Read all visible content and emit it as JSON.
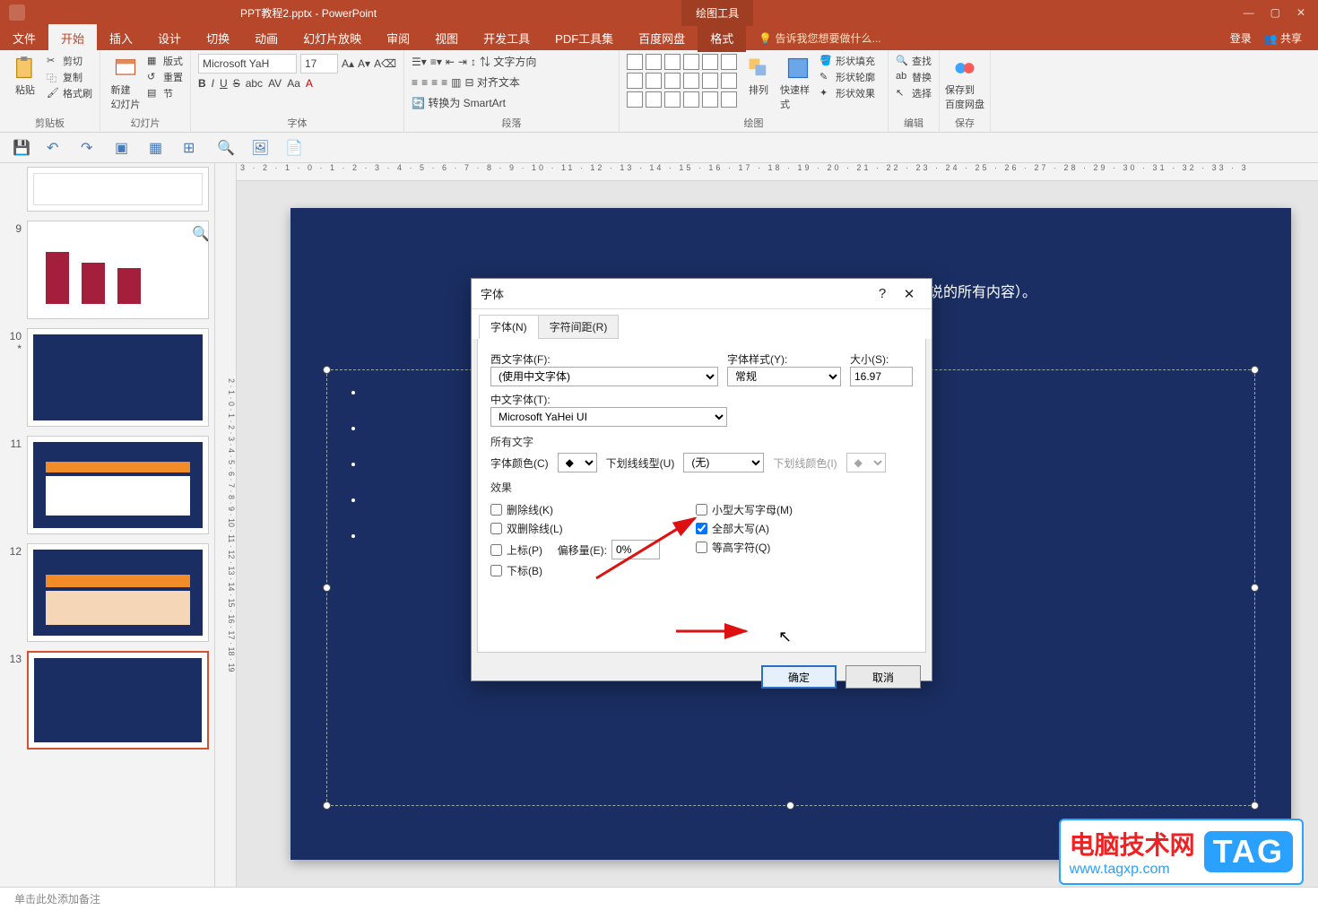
{
  "titlebar": {
    "filename": "PPT教程2.pptx - PowerPoint",
    "contextual_tab_group": "绘图工具",
    "win_min": "—",
    "win_max": "▢",
    "win_close": "✕"
  },
  "ribbon_tabs": {
    "file": "文件",
    "home": "开始",
    "insert": "插入",
    "design": "设计",
    "transitions": "切换",
    "animations": "动画",
    "slideshow": "幻灯片放映",
    "review": "审阅",
    "view": "视图",
    "developer": "开发工具",
    "pdf": "PDF工具集",
    "baidu": "百度网盘",
    "format": "格式",
    "tell_me": "告诉我您想要做什么...",
    "signin": "登录",
    "share": "共享"
  },
  "ribbon": {
    "clipboard": {
      "title": "剪贴板",
      "paste": "粘贴",
      "cut": "剪切",
      "copy": "复制",
      "painter": "格式刷"
    },
    "slides": {
      "title": "幻灯片",
      "new": "新建\n幻灯片",
      "layout": "版式",
      "reset": "重置",
      "section": "节"
    },
    "font": {
      "title": "字体",
      "name": "Microsoft YaH",
      "size": "17"
    },
    "paragraph": {
      "title": "段落",
      "direction": "文字方向",
      "align": "对齐文本",
      "smartart": "转换为 SmartArt"
    },
    "drawing": {
      "title": "绘图",
      "arrange": "排列",
      "quickstyles": "快速样式",
      "fill": "形状填充",
      "outline": "形状轮廓",
      "effects": "形状效果"
    },
    "editing": {
      "title": "编辑",
      "find": "查找",
      "replace": "替换",
      "select": "选择"
    },
    "save": {
      "title": "保存",
      "action": "保存到\n百度网盘"
    }
  },
  "slide_visible_text": "字仅作为论点（而不是你要说的所有内容）。",
  "thumbs": [
    {
      "num": ""
    },
    {
      "num": "9"
    },
    {
      "num": "10",
      "marker": "*"
    },
    {
      "num": "11"
    },
    {
      "num": "12"
    },
    {
      "num": "13"
    }
  ],
  "notes_placeholder": "单击此处添加备注",
  "dialog": {
    "title": "字体",
    "help": "?",
    "close": "✕",
    "tab_font": "字体(N)",
    "tab_spacing": "字符间距(R)",
    "latin_label": "西文字体(F):",
    "latin_value": "(使用中文字体)",
    "style_label": "字体样式(Y):",
    "style_value": "常规",
    "size_label": "大小(S):",
    "size_value": "16.97",
    "asian_label": "中文字体(T):",
    "asian_value": "Microsoft YaHei UI",
    "all_text": "所有文字",
    "font_color": "字体颜色(C)",
    "underline_style": "下划线线型(U)",
    "underline_value": "(无)",
    "underline_color": "下划线颜色(I)",
    "effects": "效果",
    "strike": "删除线(K)",
    "dstrike": "双删除线(L)",
    "superscript": "上标(P)",
    "offset_label": "偏移量(E):",
    "offset_value": "0%",
    "subscript": "下标(B)",
    "smallcaps": "小型大写字母(M)",
    "allcaps": "全部大写(A)",
    "equalize": "等高字符(Q)",
    "ok": "确定",
    "cancel": "取消"
  },
  "watermark": {
    "cn": "电脑技术网",
    "url": "www.tagxp.com",
    "tag": "TAG"
  },
  "ruler_h": "3 · 2 · 1 · 0 · 1 · 2 · 3 · 4 · 5 · 6 · 7 · 8 · 9 · 10 · 11 · 12 · 13 · 14 · 15 · 16 · 17 · 18 · 19 · 20 · 21 · 22 · 23 · 24 · 25 · 26 · 27 · 28 · 29 · 30 · 31 · 32 · 33 · 3",
  "ruler_v": "2 · 1 · 0 · 1 · 2 · 3 · 4 · 5 · 6 · 7 · 8 · 9 · 10 · 11 · 12 · 13 · 14 · 15 · 16 · 17 · 18 · 19"
}
